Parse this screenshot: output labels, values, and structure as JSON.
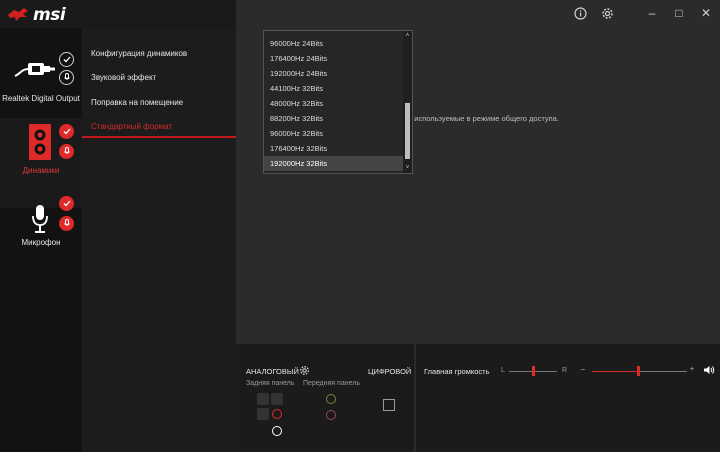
{
  "app": {
    "brand": "msi"
  },
  "titlebar": {
    "info_icon": "info-icon",
    "settings_icon": "gear-icon",
    "minimize": "–",
    "maximize": "□",
    "close": "✕"
  },
  "devices": [
    {
      "label": "Realtek Digital Output",
      "icon": "digital-output-icon",
      "badge": "check-outline"
    },
    {
      "label": "Динамики",
      "icon": "speaker-icon",
      "badge": "check-red",
      "active": true
    },
    {
      "label": "Микрофон",
      "icon": "microphone-icon",
      "badge": "check-red"
    }
  ],
  "submenu": {
    "items": [
      "Конфигурация динамиков",
      "Звуковой эффект",
      "Поправка на помещение",
      "Стандартный формат"
    ],
    "active_index": 3
  },
  "main": {
    "description_partial": "сть, используемые в режиме общего доступа."
  },
  "dropdown": {
    "options": [
      "96000Hz 24Bits",
      "176400Hz 24Bits",
      "192000Hz 24Bits",
      "44100Hz 32Bits",
      "48000Hz 32Bits",
      "88200Hz 32Bits",
      "96000Hz 32Bits",
      "176400Hz 32Bits",
      "192000Hz 32Bits"
    ],
    "selected_index": 8,
    "scroll_up": "˄",
    "scroll_down": "˅"
  },
  "bottom": {
    "analog_label": "АНАЛОГОВЫЙ",
    "digital_label": "ЦИФРОВОЙ",
    "rear_panel_label": "Задняя панель",
    "front_panel_label": "Передняя панель",
    "master_volume_label": "Главная громкость",
    "balance_left": "L",
    "balance_right": "R",
    "volume_minus": "–",
    "volume_plus": "+",
    "balance_value": 0.5,
    "volume_value": 0.5
  },
  "colors": {
    "accent": "#e02a2a",
    "jack_green": "#6a8a2a",
    "jack_pink": "#a0406a",
    "jack_red": "#e02a2a"
  }
}
